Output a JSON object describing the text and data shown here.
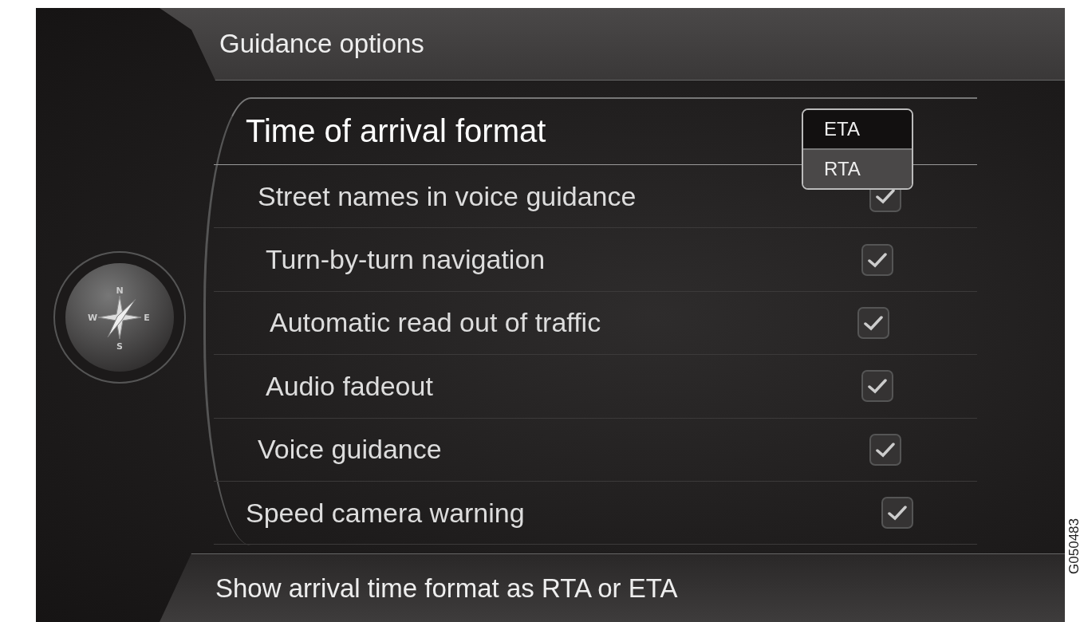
{
  "header": {
    "title": "Guidance options"
  },
  "compass": {
    "north": "N",
    "east": "E",
    "south": "S",
    "west": "W"
  },
  "options": [
    {
      "label": "Time of arrival format",
      "kind": "dropdown",
      "selected": true
    },
    {
      "label": "Street names in voice guidance",
      "kind": "checkbox",
      "checked": true,
      "selected": false
    },
    {
      "label": "Turn-by-turn navigation",
      "kind": "checkbox",
      "checked": true,
      "selected": false
    },
    {
      "label": "Automatic read out of traffic",
      "kind": "checkbox",
      "checked": true,
      "selected": false
    },
    {
      "label": "Audio fadeout",
      "kind": "checkbox",
      "checked": true,
      "selected": false
    },
    {
      "label": "Voice guidance",
      "kind": "checkbox",
      "checked": true,
      "selected": false
    },
    {
      "label": "Speed camera warning",
      "kind": "checkbox",
      "checked": true,
      "selected": false
    }
  ],
  "dropdown": {
    "options": [
      {
        "label": "ETA",
        "selected": true
      },
      {
        "label": "RTA",
        "selected": false
      }
    ]
  },
  "footer": {
    "hint": "Show arrival time format as RTA or ETA"
  },
  "figure_code": "G050483"
}
